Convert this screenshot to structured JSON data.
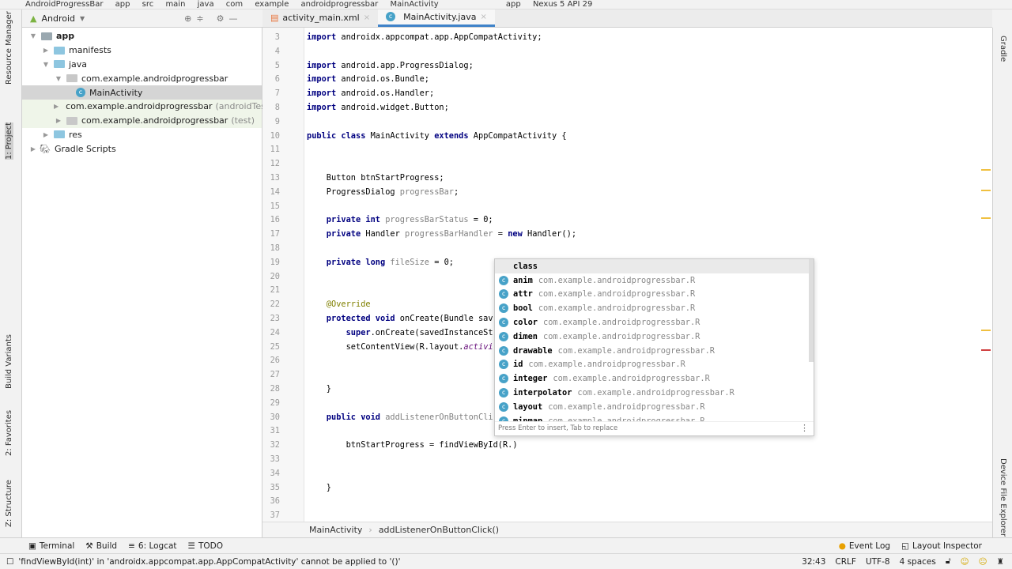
{
  "navbar": {
    "items": [
      "AndroidProgressBar",
      "app",
      "src",
      "main",
      "java",
      "com",
      "example",
      "androidprogressbar",
      "MainActivity"
    ],
    "run_config": "app",
    "device": "Nexus 5 API 29"
  },
  "project_panel": {
    "view_selector": "Android",
    "tree": [
      {
        "label": "app",
        "indent": 0,
        "expanded": true,
        "type": "module"
      },
      {
        "label": "manifests",
        "indent": 1,
        "expanded": false,
        "type": "folder"
      },
      {
        "label": "java",
        "indent": 1,
        "expanded": true,
        "type": "folder"
      },
      {
        "label": "com.example.androidprogressbar",
        "indent": 2,
        "expanded": true,
        "type": "package"
      },
      {
        "label": "MainActivity",
        "indent": 3,
        "type": "class",
        "selected": true
      },
      {
        "label": "com.example.androidprogressbar",
        "suffix": "(androidTest)",
        "indent": 2,
        "expanded": false,
        "type": "package",
        "test": true
      },
      {
        "label": "com.example.androidprogressbar",
        "suffix": "(test)",
        "indent": 2,
        "expanded": false,
        "type": "package",
        "test": true
      },
      {
        "label": "res",
        "indent": 1,
        "expanded": false,
        "type": "folder"
      },
      {
        "label": "Gradle Scripts",
        "indent": 0,
        "expanded": false,
        "type": "gradle"
      }
    ]
  },
  "left_strip": {
    "resource_manager": "Resource Manager",
    "project": "1: Project",
    "build_variants": "Build Variants",
    "favorites": "2: Favorites",
    "structure": "Z: Structure"
  },
  "right_strip": {
    "gradle": "Gradle",
    "device_file_explorer": "Device File Explorer"
  },
  "editor_tabs": [
    {
      "label": "activity_main.xml",
      "active": false
    },
    {
      "label": "MainActivity.java",
      "active": true
    }
  ],
  "code": {
    "first_line": 3,
    "current_line": 32,
    "lines": [
      [
        [
          "import ",
          "kw"
        ],
        [
          "androidx.appcompat.app.AppCompatActivity;",
          ""
        ]
      ],
      [],
      [
        [
          "import ",
          "kw"
        ],
        [
          "android.app.ProgressDialog;",
          ""
        ]
      ],
      [
        [
          "import ",
          "kw"
        ],
        [
          "android.os.Bundle;",
          ""
        ]
      ],
      [
        [
          "import ",
          "kw"
        ],
        [
          "android.os.Handler;",
          ""
        ]
      ],
      [
        [
          "import ",
          "kw"
        ],
        [
          "android.widget.Button;",
          ""
        ]
      ],
      [],
      [
        [
          "public class ",
          "kw"
        ],
        [
          "MainActivity ",
          ""
        ],
        [
          "extends ",
          "kw"
        ],
        [
          "AppCompatActivity {",
          ""
        ]
      ],
      [],
      [],
      [
        [
          "    Button ",
          ""
        ],
        [
          "btnStartProgress",
          ""
        ],
        [
          ";",
          ""
        ]
      ],
      [
        [
          "    ProgressDialog ",
          ""
        ],
        [
          "progressBar",
          "unused"
        ],
        [
          ";",
          ""
        ]
      ],
      [],
      [
        [
          "    private int ",
          "kw"
        ],
        [
          "progressBarStatus",
          "unused"
        ],
        [
          " = ",
          ""
        ],
        [
          "0",
          ""
        ],
        [
          ";",
          ""
        ]
      ],
      [
        [
          "    private ",
          "kw"
        ],
        [
          "Handler ",
          ""
        ],
        [
          "progressBarHandler",
          "unused"
        ],
        [
          " = ",
          ""
        ],
        [
          "new ",
          "kw"
        ],
        [
          "Handler();",
          ""
        ]
      ],
      [],
      [
        [
          "    private long ",
          "kw"
        ],
        [
          "fileSize",
          "unused"
        ],
        [
          " = 0;",
          ""
        ]
      ],
      [],
      [],
      [
        [
          "    @Override",
          "ann"
        ]
      ],
      [
        [
          "    protected void ",
          "kw"
        ],
        [
          "onCreate(Bundle sav",
          ""
        ]
      ],
      [
        [
          "        super",
          "kw"
        ],
        [
          ".onCreate(savedInstanceSt",
          ""
        ]
      ],
      [
        [
          "        setContentView(R.layout.",
          ""
        ],
        [
          "activi",
          "it"
        ]
      ],
      [],
      [],
      [
        [
          "    }",
          ""
        ]
      ],
      [],
      [
        [
          "    public void ",
          "kw"
        ],
        [
          "addListenerOnButtonCli",
          "unused"
        ]
      ],
      [],
      [
        [
          "        btnStartProgress = findViewById(R.)",
          ""
        ]
      ],
      [],
      [],
      [
        [
          "    }",
          ""
        ]
      ],
      [],
      []
    ]
  },
  "completion_popup": {
    "items": [
      {
        "name": "class",
        "pkg": ""
      },
      {
        "name": "anim",
        "pkg": "com.example.androidprogressbar.R"
      },
      {
        "name": "attr",
        "pkg": "com.example.androidprogressbar.R"
      },
      {
        "name": "bool",
        "pkg": "com.example.androidprogressbar.R"
      },
      {
        "name": "color",
        "pkg": "com.example.androidprogressbar.R"
      },
      {
        "name": "dimen",
        "pkg": "com.example.androidprogressbar.R"
      },
      {
        "name": "drawable",
        "pkg": "com.example.androidprogressbar.R"
      },
      {
        "name": "id",
        "pkg": "com.example.androidprogressbar.R"
      },
      {
        "name": "integer",
        "pkg": "com.example.androidprogressbar.R"
      },
      {
        "name": "interpolator",
        "pkg": "com.example.androidprogressbar.R"
      },
      {
        "name": "layout",
        "pkg": "com.example.androidprogressbar.R"
      },
      {
        "name": "mipmap",
        "pkg": "com.example.androidprogressbar.R"
      }
    ],
    "footer": "Press Enter to insert, Tab to replace"
  },
  "breadcrumb": {
    "class": "MainActivity",
    "method": "addListenerOnButtonClick()"
  },
  "tool_tabs": {
    "terminal": "Terminal",
    "build": "Build",
    "logcat": "6: Logcat",
    "todo": "TODO",
    "event_log": "Event Log",
    "layout_inspector": "Layout Inspector"
  },
  "status": {
    "message": "'findViewById(int)' in 'androidx.appcompat.app.AppCompatActivity' cannot be applied to '()'",
    "position": "32:43",
    "line_sep": "CRLF",
    "encoding": "UTF-8",
    "indent": "4 spaces"
  },
  "colors": {
    "accent": "#4083c9",
    "keyword": "#000080",
    "field": "#660e7a",
    "annotation": "#808000",
    "current_line": "#fdfbe6"
  }
}
